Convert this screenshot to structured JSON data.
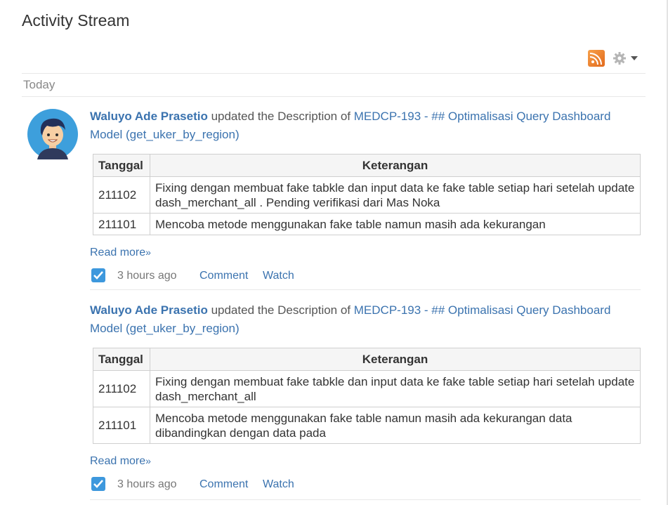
{
  "page": {
    "title": "Activity Stream"
  },
  "toolbar": {
    "rss_icon": "rss-feed-icon",
    "gear_icon": "gear-icon",
    "menu_icon": "caret-down-icon"
  },
  "group_label": "Today",
  "entries": [
    {
      "user": "Waluyo Ade Prasetio",
      "action": " updated the Description of ",
      "issue_key": "MEDCP-193",
      "issue_sep": " - ",
      "issue_summary": "## Optimalisasi Query Dashboard Model (get_uker_by_region)",
      "table": {
        "headers": [
          "Tanggal",
          "Keterangan"
        ],
        "rows": [
          [
            "211102",
            "Fixing dengan membuat fake tabkle dan input data ke fake table setiap hari setelah update dash_merchant_all . Pending verifikasi dari Mas Noka"
          ],
          [
            "211101",
            "Mencoba metode menggunakan fake table namun masih ada kekurangan"
          ]
        ]
      },
      "read_more": "Read more",
      "read_more_chevron": "»",
      "time": "3 hours ago",
      "comment": "Comment",
      "watch": "Watch"
    },
    {
      "user": "Waluyo Ade Prasetio",
      "action": " updated the Description of ",
      "issue_key": "MEDCP-193",
      "issue_sep": " - ",
      "issue_summary": "## Optimalisasi Query Dashboard Model (get_uker_by_region)",
      "table": {
        "headers": [
          "Tanggal",
          "Keterangan"
        ],
        "rows": [
          [
            "211102",
            "Fixing dengan membuat fake tabkle dan input data ke fake table setiap hari setelah update dash_merchant_all"
          ],
          [
            "211101",
            "Mencoba metode menggunakan fake table namun masih ada kekurangan data dibandingkan dengan data pada"
          ]
        ]
      },
      "read_more": "Read more",
      "read_more_chevron": "»",
      "time": "3 hours ago",
      "comment": "Comment",
      "watch": "Watch"
    }
  ]
}
